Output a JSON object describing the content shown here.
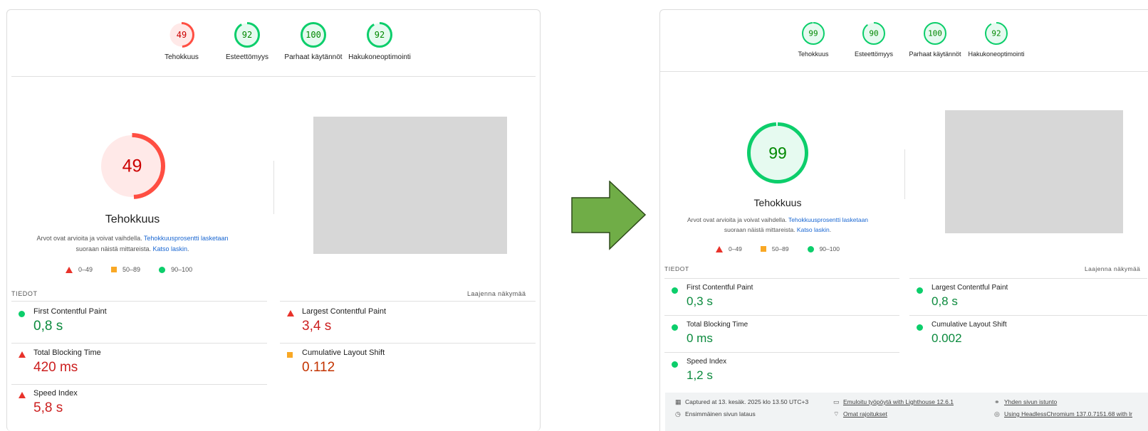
{
  "left": {
    "gauges": [
      {
        "score": "49",
        "label": "Tehokkuus",
        "value": 0.49,
        "rating": "fail"
      },
      {
        "score": "92",
        "label": "Esteettömyys",
        "value": 0.92,
        "rating": "pass"
      },
      {
        "score": "100",
        "label": "Parhaat käytännöt",
        "value": 1.0,
        "rating": "pass"
      },
      {
        "score": "92",
        "label": "Hakukoneoptimointi",
        "value": 0.92,
        "rating": "pass"
      }
    ],
    "main_score": "49",
    "main_value": 0.49,
    "main_title": "Tehokkuus",
    "desc_text1": "Arvot ovat arvioita ja voivat vaihdella.",
    "desc_link1": "Tehokkuusprosentti lasketaan",
    "desc_text2": "suoraan näistä mittareista.",
    "desc_link2": "Katso laskin",
    "desc_end": ".",
    "legend": [
      "0–49",
      "50–89",
      "90–100"
    ],
    "section": "TIEDOT",
    "expand": "Laajenna näkymää",
    "metrics": [
      {
        "title": "First Contentful Paint",
        "value": "0,8 s",
        "rating": "pass"
      },
      {
        "title": "Largest Contentful Paint",
        "value": "3,4 s",
        "rating": "fail"
      },
      {
        "title": "Total Blocking Time",
        "value": "420 ms",
        "rating": "fail"
      },
      {
        "title": "Cumulative Layout Shift",
        "value": "0.112",
        "rating": "average"
      },
      {
        "title": "Speed Index",
        "value": "5,8 s",
        "rating": "fail"
      }
    ]
  },
  "right": {
    "gauges": [
      {
        "score": "99",
        "label": "Tehokkuus",
        "value": 0.99,
        "rating": "pass"
      },
      {
        "score": "90",
        "label": "Esteettömyys",
        "value": 0.9,
        "rating": "pass"
      },
      {
        "score": "100",
        "label": "Parhaat käytännöt",
        "value": 1.0,
        "rating": "pass"
      },
      {
        "score": "92",
        "label": "Hakukoneoptimointi",
        "value": 0.92,
        "rating": "pass"
      }
    ],
    "main_score": "99",
    "main_value": 0.99,
    "main_title": "Tehokkuus",
    "desc_text1": "Arvot ovat arvioita ja voivat vaihdella.",
    "desc_link1": "Tehokkuusprosentti lasketaan",
    "desc_text2": "suoraan näistä mittareista.",
    "desc_link2": "Katso laskin",
    "desc_end": ".",
    "legend": [
      "0–49",
      "50–89",
      "90–100"
    ],
    "section": "TIEDOT",
    "expand": "Laajenna näkymää",
    "metrics": [
      {
        "title": "First Contentful Paint",
        "value": "0,3 s",
        "rating": "pass"
      },
      {
        "title": "Largest Contentful Paint",
        "value": "0,8 s",
        "rating": "pass"
      },
      {
        "title": "Total Blocking Time",
        "value": "0 ms",
        "rating": "pass"
      },
      {
        "title": "Cumulative Layout Shift",
        "value": "0.002",
        "rating": "pass"
      },
      {
        "title": "Speed Index",
        "value": "1,2 s",
        "rating": "pass"
      }
    ],
    "footer": {
      "captured": "Captured at 13. kesäk. 2025 klo 13.50 UTC+3",
      "emulated": "Emuloitu työpöytä with Lighthouse 12.6.1",
      "session": "Yhden sivun istunto",
      "initial_load": "Ensimmäinen sivun lataus",
      "throttling": "Omat rajoitukset",
      "browser": "Using HeadlessChromium 137.0.7151.68 with lr"
    }
  },
  "colors": {
    "pass": "#0cce6b",
    "average": "#ffa400",
    "fail": "#ff4e42",
    "link": "#1a67d2",
    "arrow": "#70ad47"
  },
  "arrow_icon": "right-arrow-icon"
}
